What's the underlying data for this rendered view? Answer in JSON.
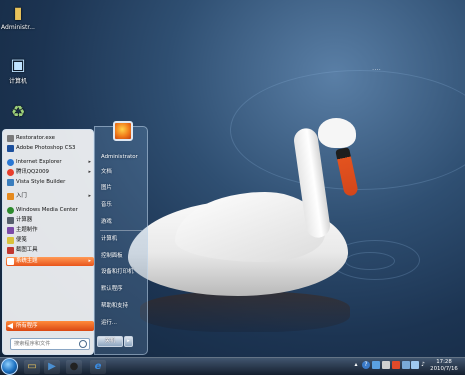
{
  "desktop": {
    "icons": [
      {
        "label": "Administr...",
        "icon": "folder-icon"
      },
      {
        "label": "计算机",
        "icon": "computer-icon"
      },
      {
        "label": "",
        "icon": "recycle-bin-icon"
      }
    ],
    "watermark": "...."
  },
  "start_menu": {
    "programs": [
      {
        "label": "Restorator.exe",
        "color": "#7a7a7a",
        "arrow": ""
      },
      {
        "label": "Adobe Photoshop CS3",
        "color": "#1c4f9c",
        "arrow": ""
      },
      {
        "label": "Internet Explorer",
        "color": "#2a78d4",
        "arrow": "▸"
      },
      {
        "label": "腾讯QQ2009",
        "color": "#e83d2b",
        "arrow": "▸"
      },
      {
        "label": "Vista Style Builder",
        "color": "#3a7dbd",
        "arrow": ""
      },
      {
        "label": "入门",
        "color": "#e58a1f",
        "arrow": "▸"
      },
      {
        "label": "Windows Media Center",
        "color": "#2d8a2d",
        "arrow": ""
      },
      {
        "label": "计算器",
        "color": "#555e6b",
        "arrow": ""
      },
      {
        "label": "主题制作",
        "color": "#7b4aa8",
        "arrow": ""
      },
      {
        "label": "便笺",
        "color": "#d9c23a",
        "arrow": ""
      },
      {
        "label": "截图工具",
        "color": "#c2372f",
        "arrow": ""
      },
      {
        "label": "系统主题",
        "color": "#ffffff",
        "arrow": "▸",
        "selected": true
      }
    ],
    "all_programs": "所有程序",
    "search_placeholder": "搜索程序和文件",
    "right_items": [
      {
        "label": "Administrator"
      },
      {
        "label": "文档"
      },
      {
        "label": "图片"
      },
      {
        "label": "音乐"
      },
      {
        "label": "游戏"
      },
      {
        "label": "计算机"
      },
      {
        "label": "控制面板"
      },
      {
        "label": "设备和打印机"
      },
      {
        "label": "默认程序"
      },
      {
        "label": "帮助和支持"
      },
      {
        "label": "运行..."
      }
    ],
    "shutdown_label": "关机",
    "shutdown_arrow": "▸"
  },
  "taskbar": {
    "pinned": [
      {
        "icon": "folder-icon",
        "glyph": "▭",
        "color": "#e8c25a"
      },
      {
        "icon": "media-player-icon",
        "glyph": "▶",
        "color": "#4a8fd1"
      },
      {
        "icon": "qq-penguin-icon",
        "glyph": "●",
        "color": "#222222"
      },
      {
        "icon": "internet-explorer-icon",
        "glyph": "e",
        "color": "#3a8be0"
      }
    ],
    "clock_time": "17:28",
    "clock_date": "2010/7/16"
  }
}
